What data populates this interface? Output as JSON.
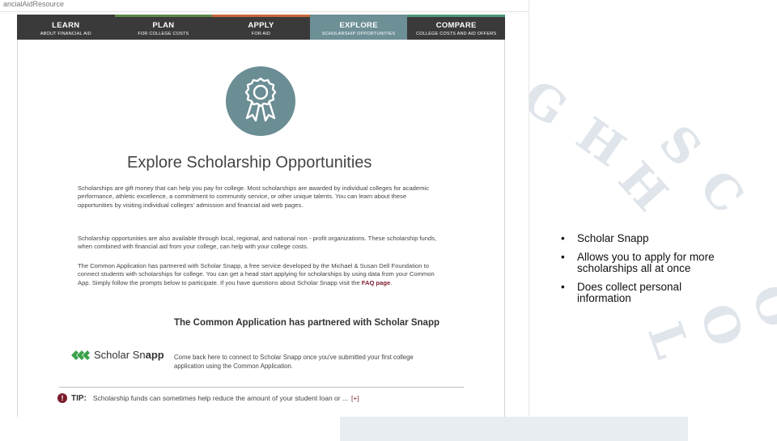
{
  "browser": {
    "url_fragment": "ancialAidResource"
  },
  "nav": {
    "tabs": [
      {
        "label": "LEARN",
        "sub": "ABOUT FINANCIAL AID",
        "accent": "#3a3a3a"
      },
      {
        "label": "PLAN",
        "sub": "FOR COLLEGE COSTS",
        "accent": "#5e8a4a"
      },
      {
        "label": "APPLY",
        "sub": "FOR AID",
        "accent": "#c8683a"
      },
      {
        "label": "EXPLORE",
        "sub": "SCHOLARSHIP OPPORTUNITIES",
        "accent": "#6d8f96",
        "active": true
      },
      {
        "label": "COMPARE",
        "sub": "COLLEGE COSTS AND AID OFFERS",
        "accent": "#4a9a78"
      }
    ]
  },
  "main": {
    "icon": "award-ribbon-icon",
    "title": "Explore Scholarship Opportunities",
    "paragraph1": "Scholarships are gift money that can help you pay for college. Most scholarships are awarded by individual colleges for academic performance, athletic excellence, a commitment to community service, or other unique talents. You can learn about these opportunities by visiting individual colleges' admission and financial aid web pages.",
    "paragraph2": "Scholarship opportunities are also available through local, regional, and national non - profit organizations. These scholarship funds, when combined with financial aid from your college, can help with your college costs.",
    "paragraph3": "The Common Application has partnered with Scholar Snapp, a free service developed by the Michael & Susan Dell Foundation to connect students with scholarships for college. You can get a head start applying for scholarships by using data from your Common App. Simply follow the prompts below to participate. If you have questions about Scholar Snapp visit the",
    "faq_link": "FAQ page",
    "partner_title": "The Common Application has partnered with Scholar Snapp",
    "logo_text_a": "Scholar Sn",
    "logo_text_b": "app",
    "come_back": "Come back here to connect to Scholar Snapp once you've submitted your first college application using the Common Application.",
    "tip_label": "TIP:",
    "tip_text": "Scholarship funds can sometimes help reduce the amount of your student loan or ...",
    "tip_more": "[+]"
  },
  "slide": {
    "bullets": [
      "Scholar Snapp",
      "Allows you to apply for more scholarships all at once",
      "Does collect personal information"
    ]
  },
  "watermark": {
    "line1": "G H",
    "line2": "S C H",
    "line3": "O O L"
  },
  "colors": {
    "badge": "#6b8d94",
    "link": "#7a1b2b",
    "nav_bg": "#3a3a3a"
  }
}
